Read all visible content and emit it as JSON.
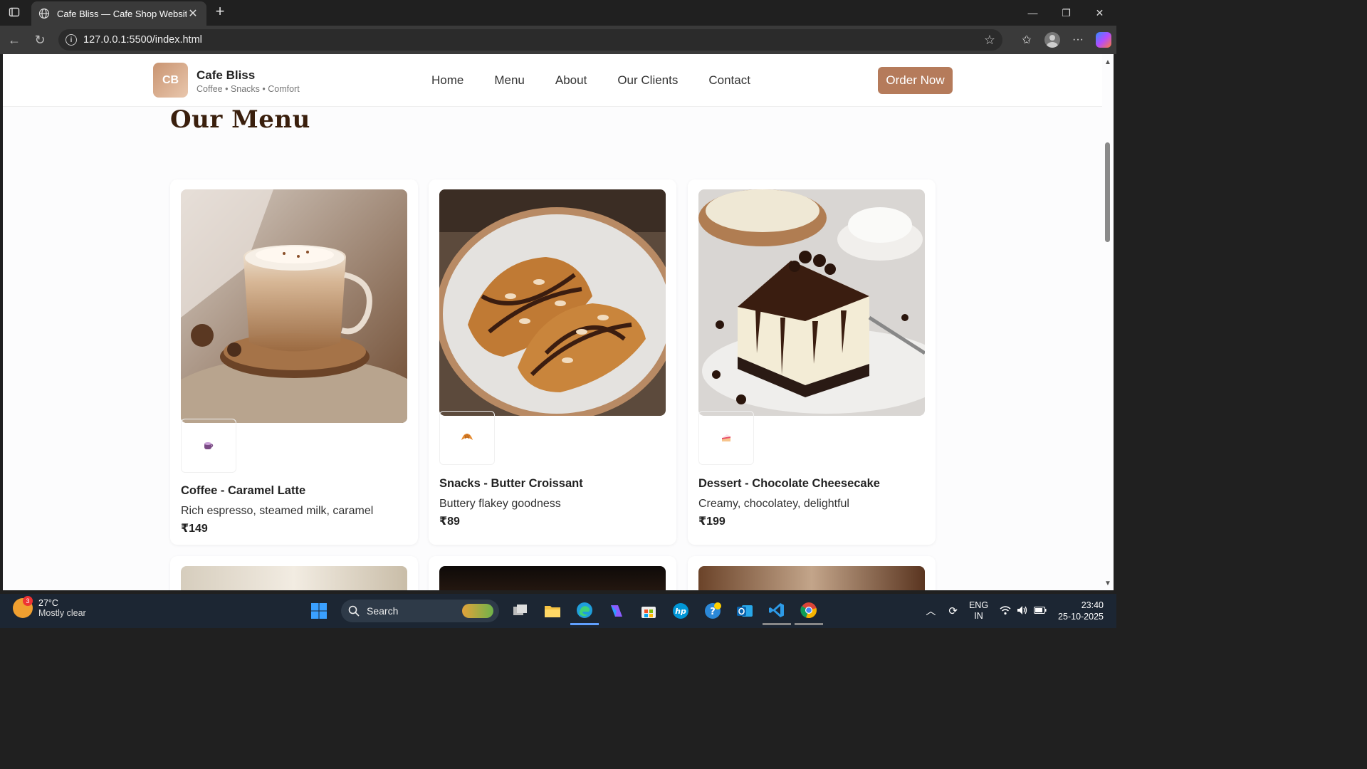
{
  "browser": {
    "tab_title": "Cafe Bliss — Cafe Shop Website",
    "url": "127.0.0.1:5500/index.html"
  },
  "header": {
    "logo_initials": "CB",
    "brand_name": "Cafe Bliss",
    "tagline": "Coffee • Snacks • Comfort",
    "nav": [
      "Home",
      "Menu",
      "About",
      "Our Clients",
      "Contact"
    ],
    "cta_label": "Order Now"
  },
  "menu": {
    "title": "Our Menu",
    "items": [
      {
        "name": "Coffee - Caramel Latte",
        "desc": "Rich espresso, steamed milk, caramel",
        "price": "₹149",
        "icon": "coffee-cup-icon"
      },
      {
        "name": "Snacks - Butter Croissant",
        "desc": "Buttery flakey goodness",
        "price": "₹89",
        "icon": "croissant-icon"
      },
      {
        "name": "Dessert - Chocolate Cheesecake",
        "desc": "Creamy, chocolatey, delightful",
        "price": "₹199",
        "icon": "cake-slice-icon"
      }
    ]
  },
  "taskbar": {
    "weather_badge": "3",
    "temperature": "27°C",
    "condition": "Mostly clear",
    "search_label": "Search",
    "lang_1": "ENG",
    "lang_2": "IN",
    "time": "23:40",
    "date": "25-10-2025"
  },
  "colors": {
    "accent": "#b57b5b",
    "title": "#3a1f0d",
    "taskbar": "#1c2633"
  }
}
